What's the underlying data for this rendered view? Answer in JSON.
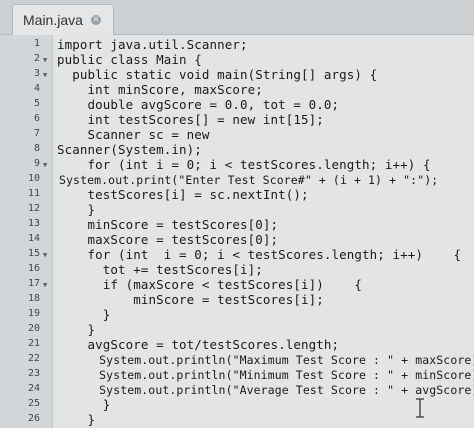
{
  "tab": {
    "title": "Main.java",
    "close_icon": "close-icon"
  },
  "gutter": {
    "line_numbers": [
      "1",
      "2",
      "3",
      "4",
      "5",
      "6",
      "7",
      "8",
      "9",
      "10",
      "11",
      "12",
      "13",
      "14",
      "15",
      "16",
      "17",
      "18",
      "19",
      "20",
      "21",
      "22",
      "23",
      "24",
      "25",
      "26"
    ],
    "fold_markers": [
      "2",
      "3",
      "9",
      "15",
      "17"
    ]
  },
  "code": [
    "import java.util.Scanner;",
    "public class Main {",
    "  public static void main(String[] args) {",
    "    int minScore, maxScore;",
    "    double avgScore = 0.0, tot = 0.0;",
    "    int testScores[] = new int[15];",
    "    Scanner sc = new",
    "Scanner(System.in);",
    "    for (int i = 0; i < testScores.length; i++) {",
    "System.out.print(\"Enter Test Score#\" + (i + 1) + \":\");",
    "    testScores[i] = sc.nextInt();",
    "    }",
    "    minScore = testScores[0];",
    "    maxScore = testScores[0];",
    "    for (int  i = 0; i < testScores.length; i++)    {",
    "      tot += testScores[i];",
    "      if (maxScore < testScores[i])    {",
    "          minScore = testScores[i];",
    "      }",
    "    }",
    "    avgScore = tot/testScores.length;",
    "      System.out.println(\"Maximum Test Score : \" + maxScore);",
    "      System.out.println(\"Minimum Test Score : \" + minScore);",
    "      System.out.println(\"Average Test Score : \" + avgScore);",
    "      }",
    "    }"
  ]
}
